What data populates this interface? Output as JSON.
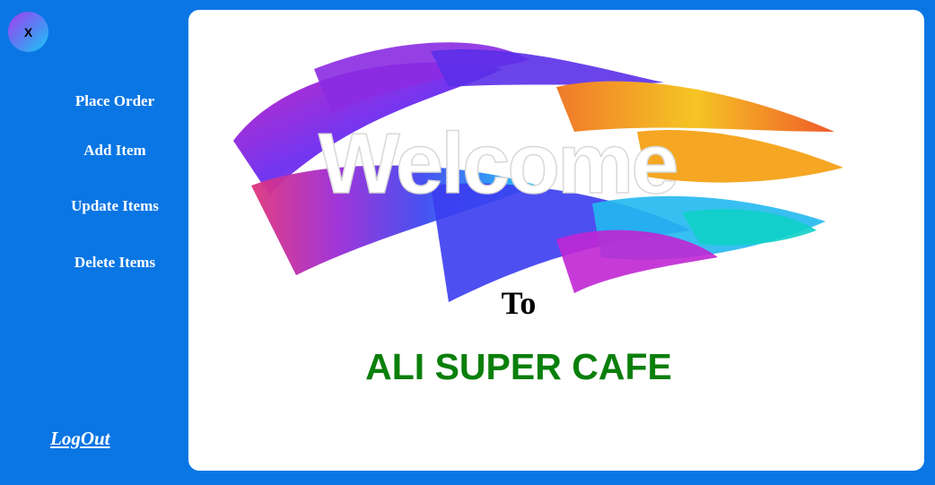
{
  "close_button": {
    "label": "X"
  },
  "sidebar": {
    "items": [
      {
        "label": "Place Order"
      },
      {
        "label": "Add Item"
      },
      {
        "label": "Update Items"
      },
      {
        "label": "Delete Items"
      }
    ],
    "logout_label": "LogOut"
  },
  "main": {
    "welcome_word": "Welcome",
    "to_text": "To",
    "cafe_name": "ALI SUPER CAFE"
  },
  "colors": {
    "sidebar_background": "#0a76e4",
    "panel_background": "#ffffff",
    "cafe_name": "#0a7f0a",
    "menu_text": "#ffffff"
  }
}
